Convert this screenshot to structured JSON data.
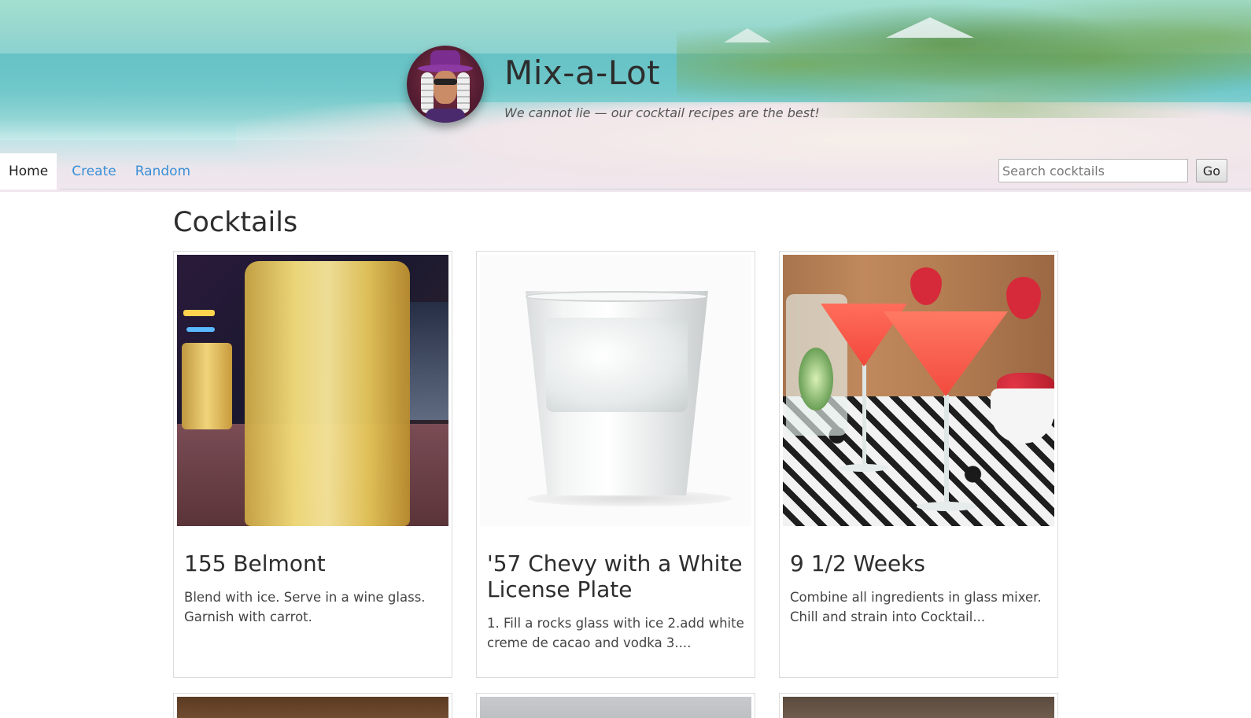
{
  "site": {
    "title": "Mix-a-Lot",
    "tagline": "We cannot lie — our cocktail recipes are the best!"
  },
  "nav": {
    "tabs": [
      {
        "label": "Home",
        "active": true
      },
      {
        "label": "Create",
        "active": false
      },
      {
        "label": "Random",
        "active": false
      }
    ]
  },
  "search": {
    "placeholder": "Search cocktails",
    "value": "",
    "button_label": "Go"
  },
  "main": {
    "heading": "Cocktails",
    "cards": [
      {
        "title": "155 Belmont",
        "description": "Blend with ice. Serve in a wine glass. Garnish with carrot."
      },
      {
        "title": "'57 Chevy with a White License Plate",
        "description": "1. Fill a rocks glass with ice 2.add white creme de cacao and vodka 3...."
      },
      {
        "title": "9 1/2 Weeks",
        "description": "Combine all ingredients in glass mixer. Chill and strain into Cocktail..."
      }
    ]
  },
  "colors": {
    "link": "#3a8fd6",
    "text": "#2d2d2d",
    "card_border": "#dcdcdc"
  }
}
